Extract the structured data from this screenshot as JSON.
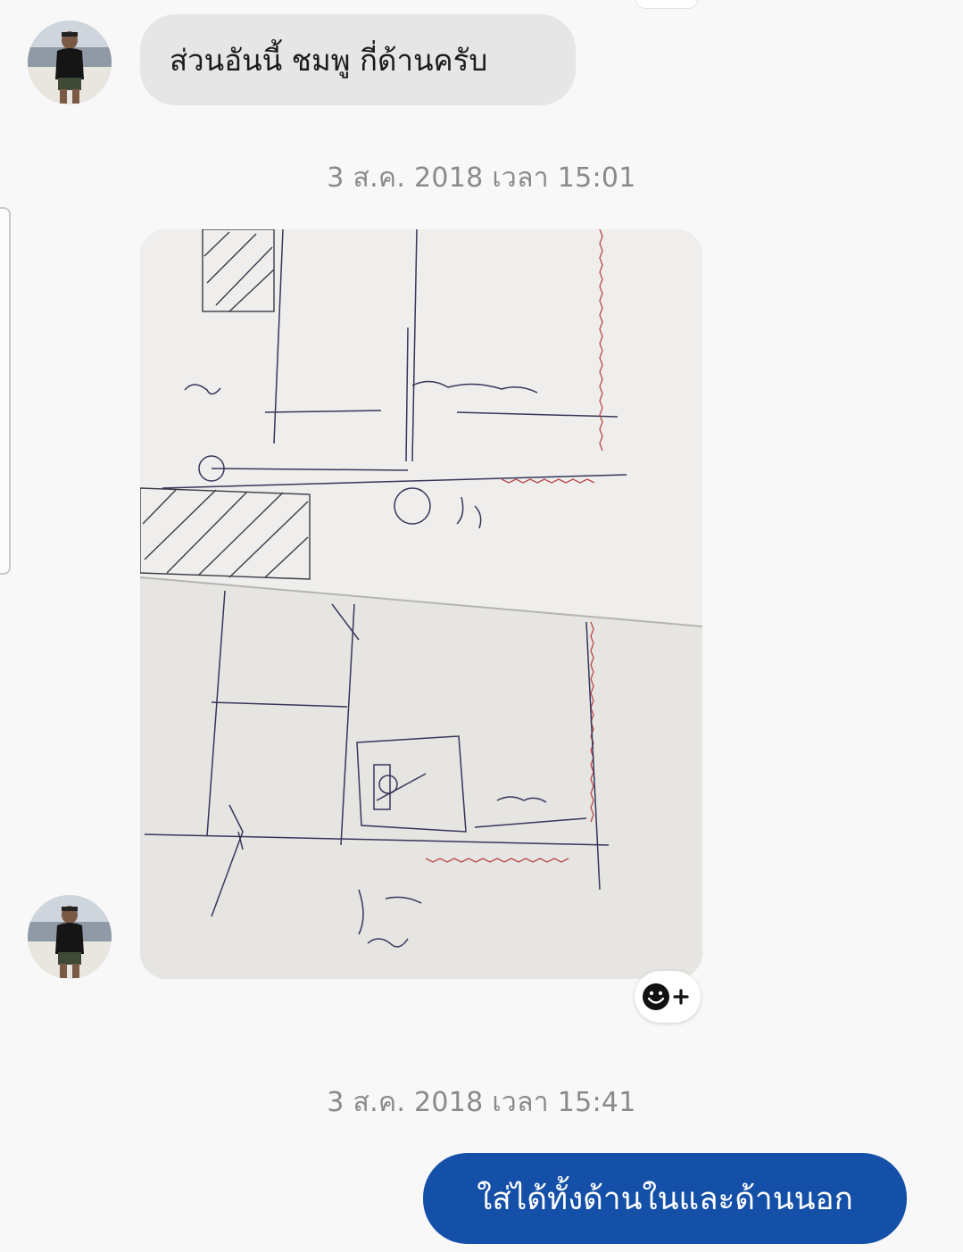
{
  "messages": {
    "incoming_text": "ส่วนอันนี้ ชมพู กี่ด้านครับ",
    "outgoing_text": "ใส่ได้ทั้งด้านในและด้านนอก"
  },
  "timestamps": {
    "first": "3 ส.ค. 2018 เวลา 15:01",
    "second": "3 ส.ค. 2018 เวลา 15:41"
  },
  "icons": {
    "avatar": "person-avatar",
    "reaction": "smiley-plus-icon"
  },
  "colors": {
    "incoming_bubble": "#e6e6e6",
    "outgoing_bubble": "#1550a8",
    "timestamp_text": "#8a8a8a",
    "background": "#f8f8f8"
  }
}
